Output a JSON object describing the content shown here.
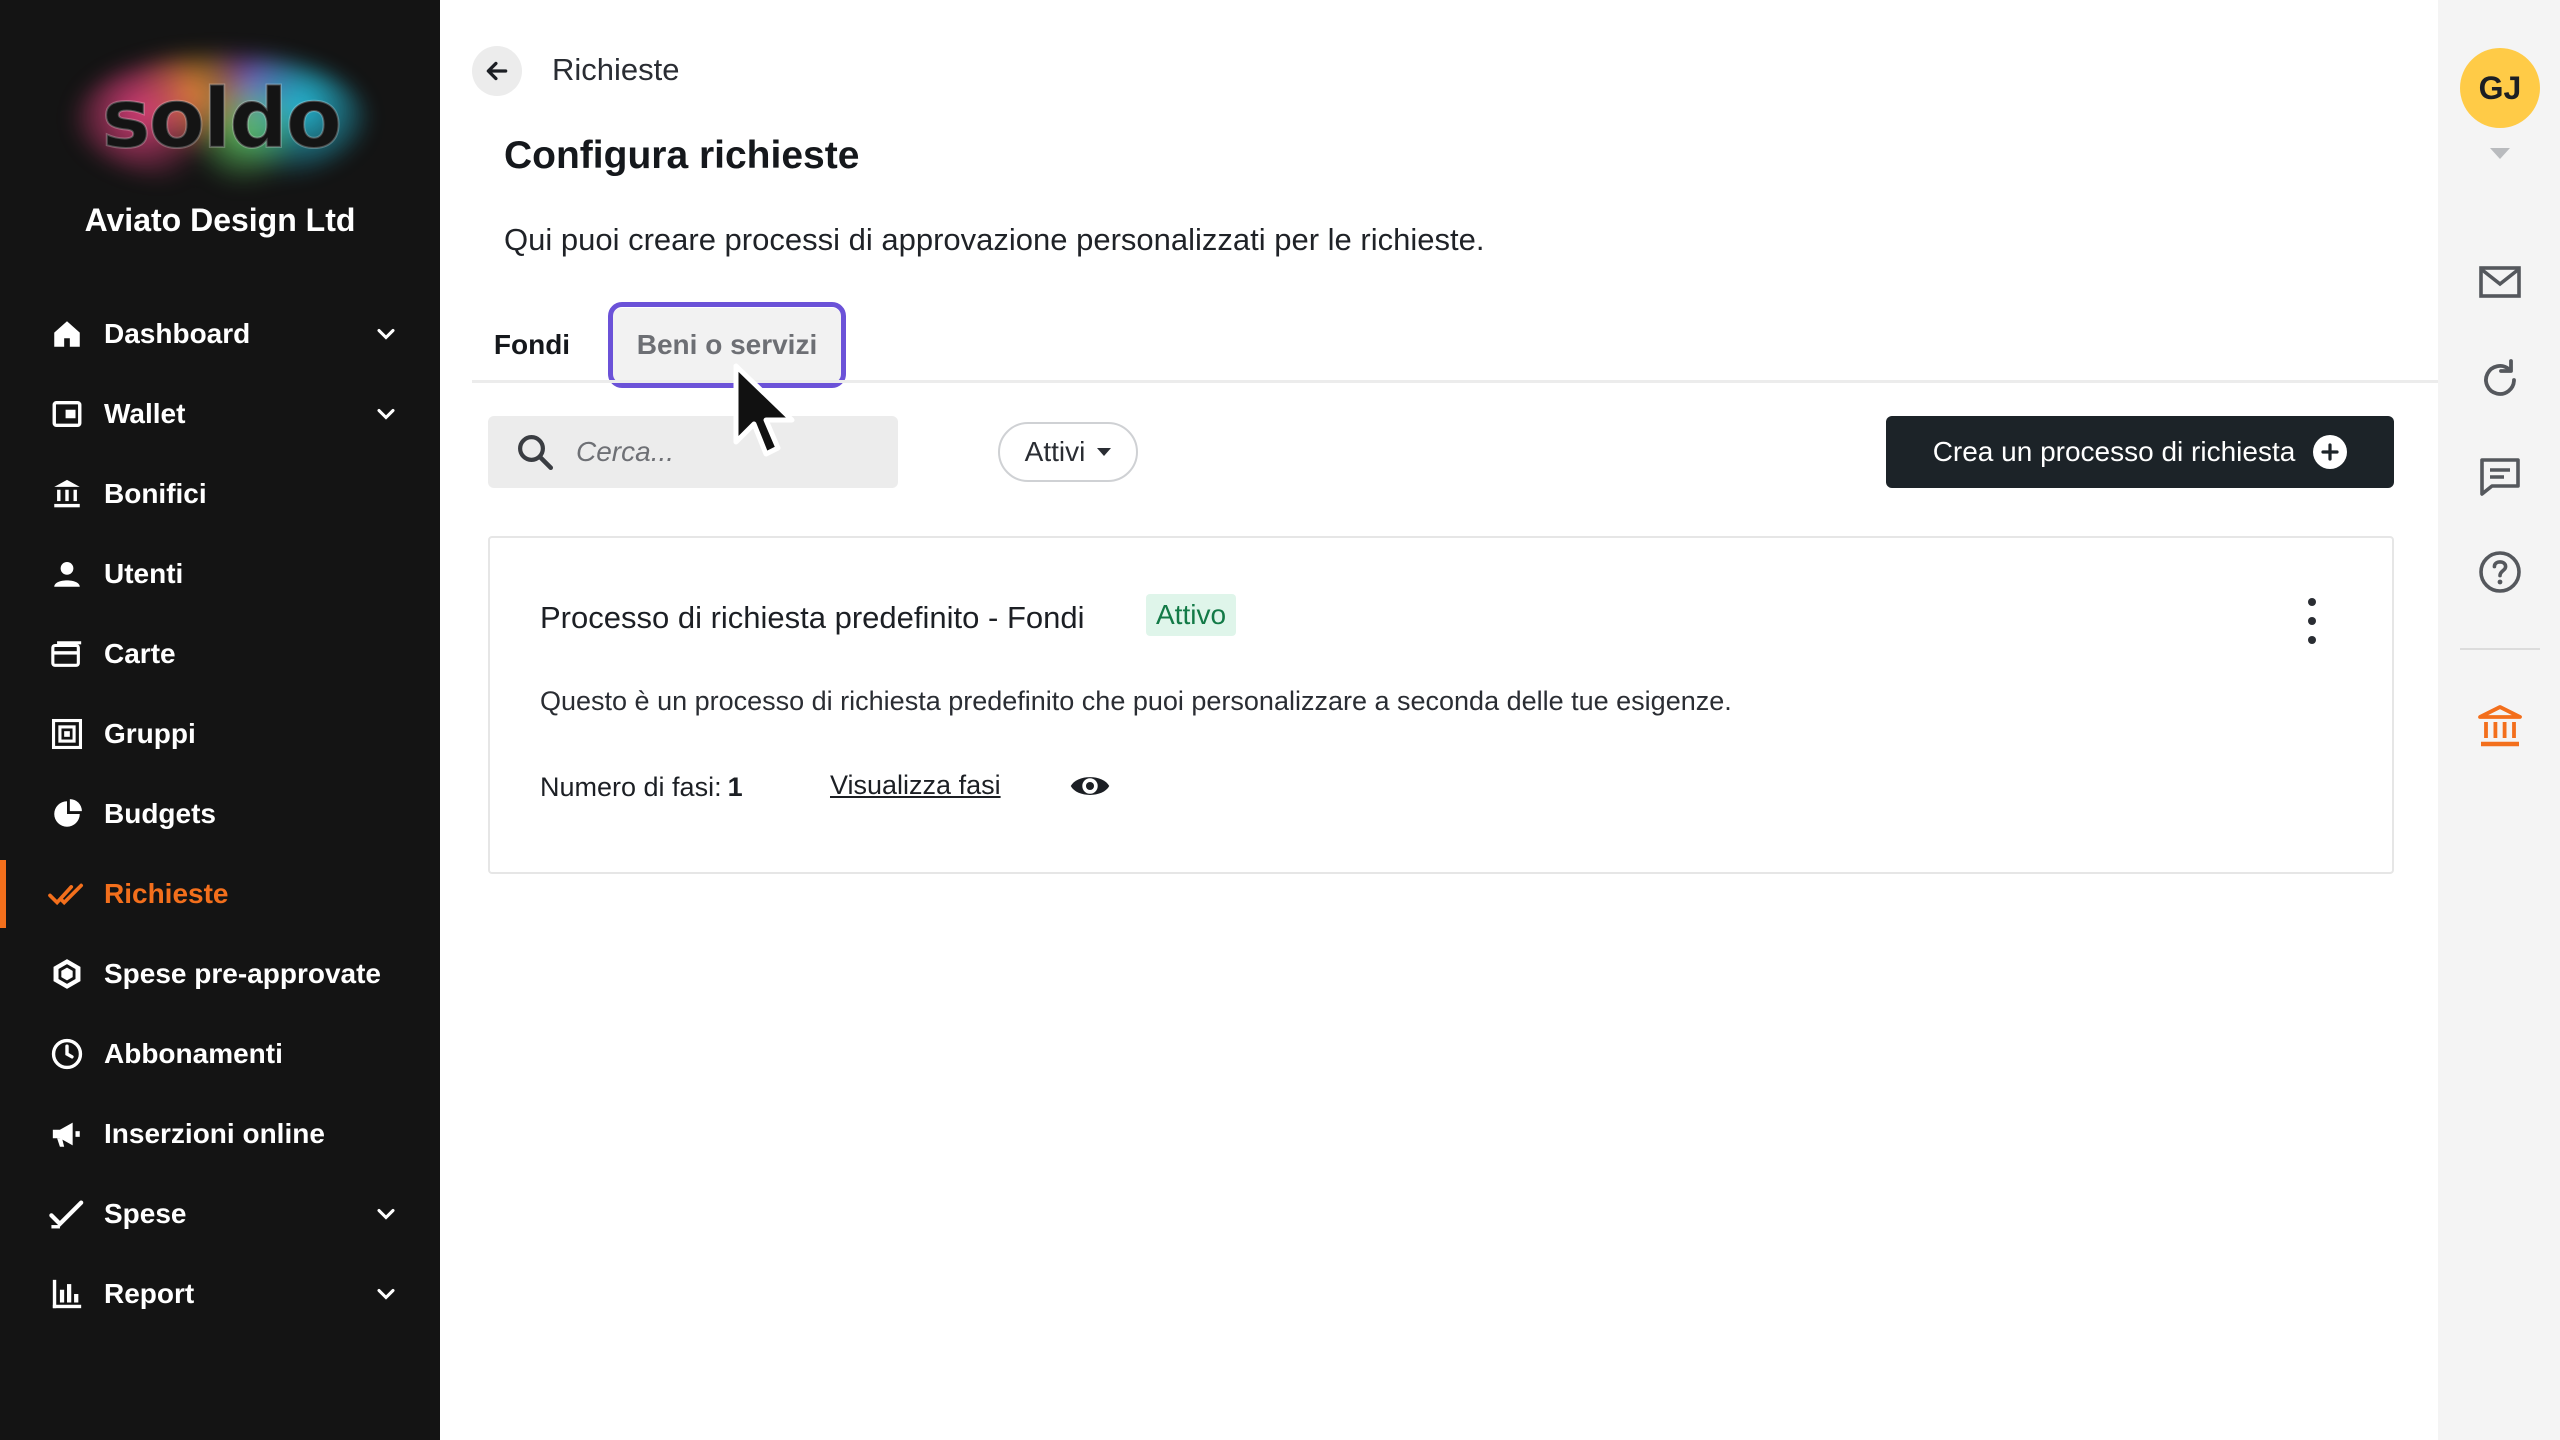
{
  "sidebar": {
    "logo_text": "soldo",
    "company": "Aviato Design Ltd",
    "items": [
      {
        "label": "Dashboard",
        "icon": "home-icon",
        "expandable": true
      },
      {
        "label": "Wallet",
        "icon": "wallet-icon",
        "expandable": true
      },
      {
        "label": "Bonifici",
        "icon": "bank-transfer-icon",
        "expandable": false
      },
      {
        "label": "Utenti",
        "icon": "user-icon",
        "expandable": false
      },
      {
        "label": "Carte",
        "icon": "card-icon",
        "expandable": false
      },
      {
        "label": "Gruppi",
        "icon": "groups-icon",
        "expandable": false
      },
      {
        "label": "Budgets",
        "icon": "pie-chart-icon",
        "expandable": false
      },
      {
        "label": "Richieste",
        "icon": "double-check-icon",
        "expandable": false,
        "active": true
      },
      {
        "label": "Spese pre-approvate",
        "icon": "hexagon-check-icon",
        "expandable": false
      },
      {
        "label": "Abbonamenti",
        "icon": "clock-icon",
        "expandable": false
      },
      {
        "label": "Inserzioni online",
        "icon": "megaphone-icon",
        "expandable": false
      },
      {
        "label": "Spese",
        "icon": "check-icon",
        "expandable": true
      },
      {
        "label": "Report",
        "icon": "bar-chart-icon",
        "expandable": true
      }
    ]
  },
  "header": {
    "breadcrumb": "Richieste",
    "title": "Configura richieste",
    "description": "Qui puoi creare processi di approvazione personalizzati per le richieste."
  },
  "tabs": [
    {
      "label": "Fondi",
      "selected": true
    },
    {
      "label": "Beni o servizi",
      "selected": false,
      "focused": true
    }
  ],
  "toolbar": {
    "search_placeholder": "Cerca...",
    "filter_value": "Attivi",
    "create_label": "Crea un processo di richiesta"
  },
  "card": {
    "title": "Processo di richiesta predefinito - Fondi",
    "status": "Attivo",
    "description": "Questo è un processo di richiesta predefinito che puoi personalizzare a seconda delle tue esigenze.",
    "steps_label": "Numero di fasi:",
    "steps_value": "1",
    "view_link": "Visualizza fasi"
  },
  "rail": {
    "avatar_initials": "GJ",
    "icons": [
      "mail-icon",
      "refresh-icon",
      "chat-icon",
      "help-icon",
      "bank-icon"
    ]
  },
  "colors": {
    "accent": "#f36f1c",
    "sidebar_bg": "#141414",
    "focus_ring": "#6b52d8",
    "badge_bg": "#dff5ea",
    "badge_text": "#137a47",
    "avatar_bg": "#ffcb47"
  }
}
